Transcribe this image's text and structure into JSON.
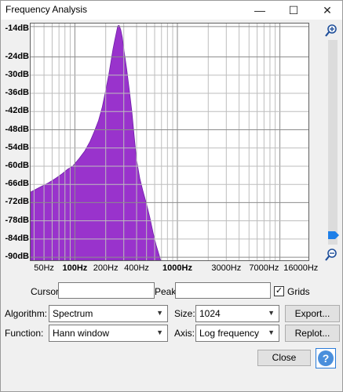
{
  "window": {
    "title": "Frequency Analysis",
    "minimize": "—",
    "maximize": "☐",
    "close": "✕"
  },
  "plot": {
    "db_ticks": [
      "-14dB",
      "-24dB",
      "-30dB",
      "-36dB",
      "-42dB",
      "-48dB",
      "-54dB",
      "-60dB",
      "-66dB",
      "-72dB",
      "-78dB",
      "-84dB",
      "-90dB"
    ],
    "bold_db": [
      "-14dB",
      "-24dB",
      "-48dB",
      "-72dB",
      "-90dB"
    ],
    "freq_ticks": [
      "50Hz",
      "100Hz",
      "200Hz",
      "400Hz",
      "1000Hz",
      "3000Hz",
      "7000Hz",
      "16000Hz"
    ],
    "bold_freq": [
      "100Hz",
      "1000Hz"
    ],
    "colors": {
      "spectrum": "#9933cc",
      "spectrum_edge": "#6f1fa8",
      "grid_minor": "#bdbdbd",
      "grid_major": "#8c8c8c"
    }
  },
  "chart_data": {
    "type": "area",
    "xscale": "log",
    "xlim": [
      37,
      19000
    ],
    "ylim": [
      -91,
      -13
    ],
    "grid": true,
    "xlabel": "",
    "ylabel": "",
    "x": [
      37,
      45,
      55,
      65,
      75,
      85,
      95,
      110,
      125,
      140,
      155,
      170,
      185,
      200,
      215,
      225,
      235,
      245,
      255,
      262,
      270,
      280,
      290,
      305,
      320,
      340,
      360,
      380,
      400,
      430,
      460,
      500,
      540,
      580,
      620,
      660,
      700
    ],
    "values": [
      -68.5,
      -67,
      -65.5,
      -64,
      -62.5,
      -61,
      -60,
      -57.5,
      -55,
      -52,
      -48.5,
      -45,
      -40.5,
      -35,
      -29.5,
      -25.5,
      -21.5,
      -18.5,
      -15.7,
      -13.8,
      -13.6,
      -15,
      -17.5,
      -23,
      -28,
      -35,
      -42,
      -50.5,
      -58,
      -64,
      -68,
      -72.5,
      -77,
      -82,
      -86,
      -89,
      -92
    ]
  },
  "cursor_label": "Cursor:",
  "cursor_value": "",
  "peak_label": "Peak:",
  "peak_value": "",
  "grids": {
    "label": "Grids",
    "checked": "✓"
  },
  "algorithm": {
    "label": "Algorithm:",
    "value": "Spectrum"
  },
  "size": {
    "label": "Size:",
    "value": "1024"
  },
  "function": {
    "label": "Function:",
    "value": "Hann window"
  },
  "axis": {
    "label": "Axis:",
    "value": "Log frequency"
  },
  "buttons": {
    "export": "Export...",
    "replot": "Replot...",
    "close": "Close",
    "help": "?"
  },
  "zoom": {
    "in_icon": "zoom-in-icon",
    "out_icon": "zoom-out-icon"
  }
}
